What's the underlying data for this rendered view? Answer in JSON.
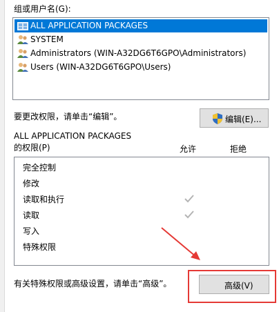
{
  "group_label": "组或用户名(G):",
  "principals": [
    {
      "name": "ALL APPLICATION PACKAGES",
      "icon": "app-packages-icon",
      "selected": true
    },
    {
      "name": "SYSTEM",
      "icon": "users-icon",
      "selected": false
    },
    {
      "name": "Administrators (WIN-A32DG6T6GPO\\Administrators)",
      "icon": "users-icon",
      "selected": false
    },
    {
      "name": "Users (WIN-A32DG6T6GPO\\Users)",
      "icon": "users-icon",
      "selected": false
    }
  ],
  "edit_hint": "要更改权限，请单击“编辑”。",
  "edit_button": {
    "label": "编辑(E)...",
    "icon": "uac-shield-icon"
  },
  "permissions_for": "ALL APPLICATION PACKAGES",
  "permissions_title": "的权限(P)",
  "columns": {
    "allow": "允许",
    "deny": "拒绝"
  },
  "permissions": [
    {
      "name": "完全控制",
      "allow": false,
      "deny": false
    },
    {
      "name": "修改",
      "allow": false,
      "deny": false
    },
    {
      "name": "读取和执行",
      "allow": true,
      "deny": false
    },
    {
      "name": "读取",
      "allow": true,
      "deny": false
    },
    {
      "name": "写入",
      "allow": false,
      "deny": false
    },
    {
      "name": "特殊权限",
      "allow": false,
      "deny": false
    }
  ],
  "advanced_hint": "有关特殊权限或高级设置，请单击“高级”。",
  "advanced_button": {
    "label": "高级(V)"
  },
  "colors": {
    "selection": "#0078d7",
    "annotation": "#e53935",
    "check": "#b4b4b4"
  }
}
